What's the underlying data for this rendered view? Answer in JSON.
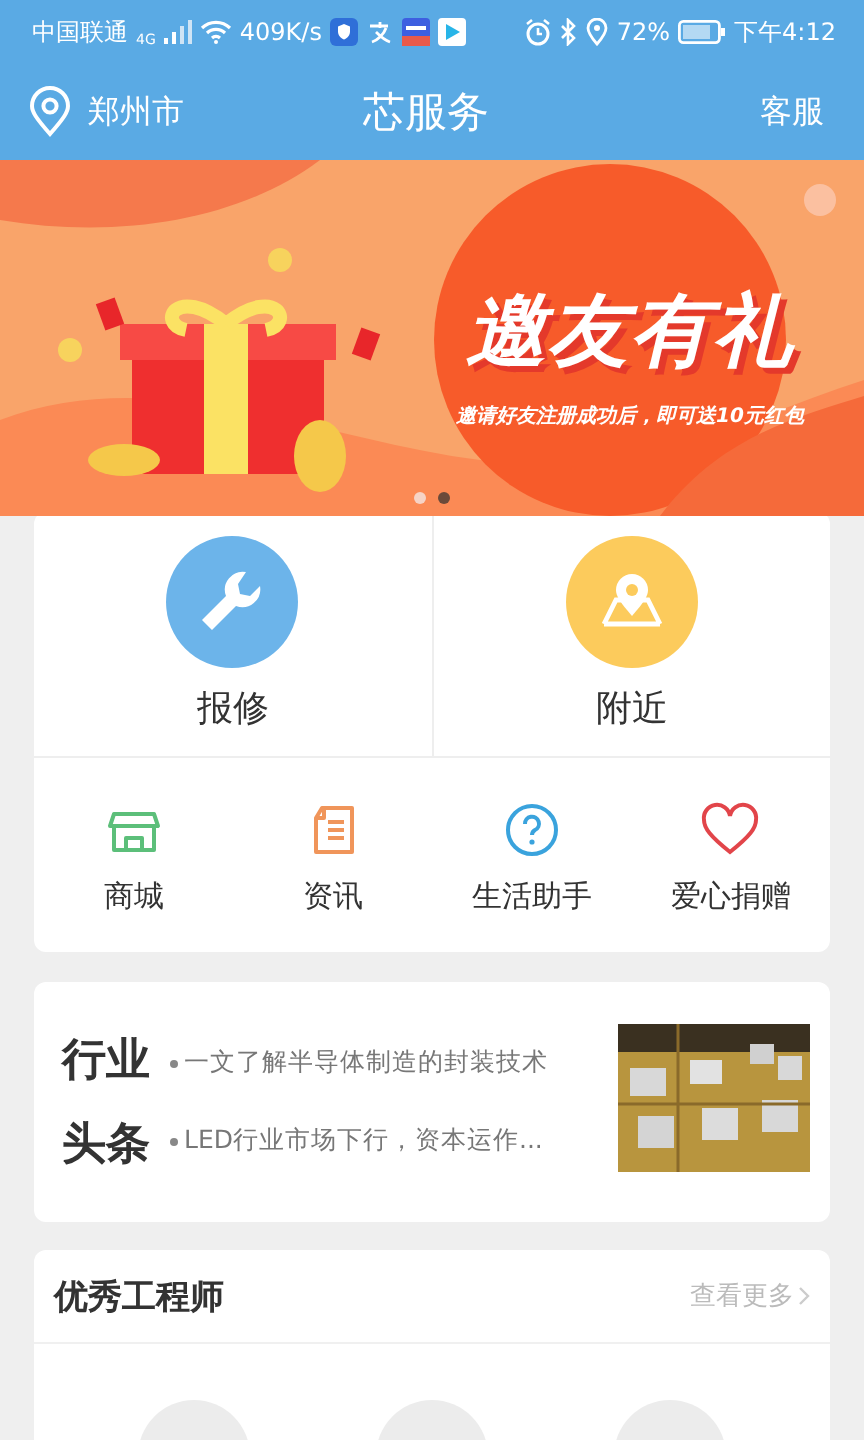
{
  "status_bar": {
    "carrier": "中国联通",
    "network": "4G",
    "speed": "409K/s",
    "battery": "72%",
    "time": "下午4:12"
  },
  "header": {
    "location": "郑州市",
    "title": "芯服务",
    "action": "客服"
  },
  "banner": {
    "headline": "邀友有礼",
    "caption": "邀请好友注册成功后，即可送10元红包",
    "dots": [
      {
        "selected": false
      },
      {
        "selected": true
      }
    ]
  },
  "main_services": [
    {
      "label": "报修",
      "kind": "wrench",
      "color": "#6cb4ea"
    },
    {
      "label": "附近",
      "kind": "map",
      "color": "#fccb5c"
    }
  ],
  "services": [
    {
      "label": "商城",
      "kind": "store",
      "color": "#5cbf7a"
    },
    {
      "label": "资讯",
      "kind": "doc",
      "color": "#f0955a"
    },
    {
      "label": "生活助手",
      "kind": "help",
      "color": "#3aa3dd"
    },
    {
      "label": "爱心捐赠",
      "kind": "heart",
      "color": "#e2454a"
    }
  ],
  "news": {
    "title_lines": [
      "行业",
      "头条"
    ],
    "items": [
      "一文了解半导体制造的封装技术",
      "LED行业市场下行，资本运作..."
    ]
  },
  "engineers": {
    "title": "优秀工程师",
    "more": "查看更多"
  }
}
